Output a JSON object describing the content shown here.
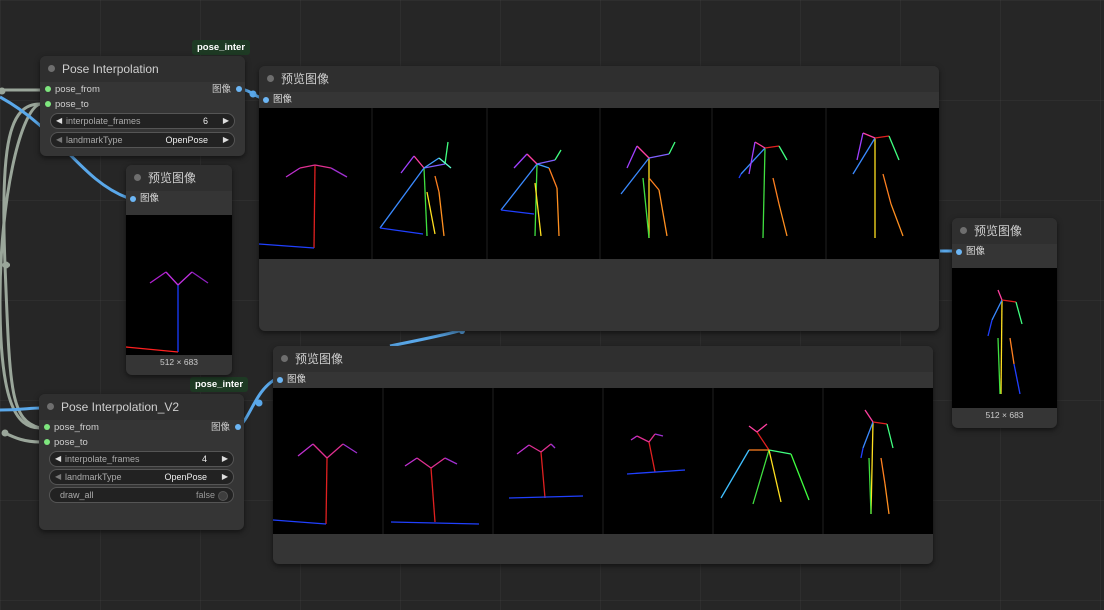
{
  "colors": {
    "canvas": "#262626",
    "node_body": "#353535",
    "node_title": "#2f2f2f",
    "input_dot": "#7ee67e",
    "image_dot": "#6cb6f5",
    "link": "#5aa8ea",
    "link_gray": "#9aa69a",
    "badge_bg": "#1e3a24"
  },
  "badges": [
    "pose_inter",
    "pose_inter"
  ],
  "node_interp": {
    "title": "Pose Interpolation",
    "input_from": "pose_from",
    "input_to": "pose_to",
    "output": "图像",
    "frames_label": "interpolate_frames",
    "frames_value": "6",
    "landmark_label": "landmarkType",
    "landmark_value": "OpenPose"
  },
  "node_interp_v2": {
    "title": "Pose Interpolation_V2",
    "input_from": "pose_from",
    "input_to": "pose_to",
    "output": "图像",
    "frames_label": "interpolate_frames",
    "frames_value": "4",
    "landmark_label": "landmarkType",
    "landmark_value": "OpenPose",
    "draw_all_label": "draw_all",
    "draw_all_value": "false"
  },
  "preview_small": {
    "title": "预览图像",
    "input": "图像",
    "size": "512 × 683"
  },
  "preview_top": {
    "title": "预览图像",
    "input": "图像"
  },
  "preview_bottom": {
    "title": "预览图像",
    "input": "图像"
  },
  "preview_right": {
    "title": "预览图像",
    "input": "图像",
    "size": "512 × 683"
  },
  "icons": [
    "arrow-left-icon",
    "arrow-right-icon",
    "toggle-knob-icon",
    "node-collapse-dot-icon"
  ]
}
